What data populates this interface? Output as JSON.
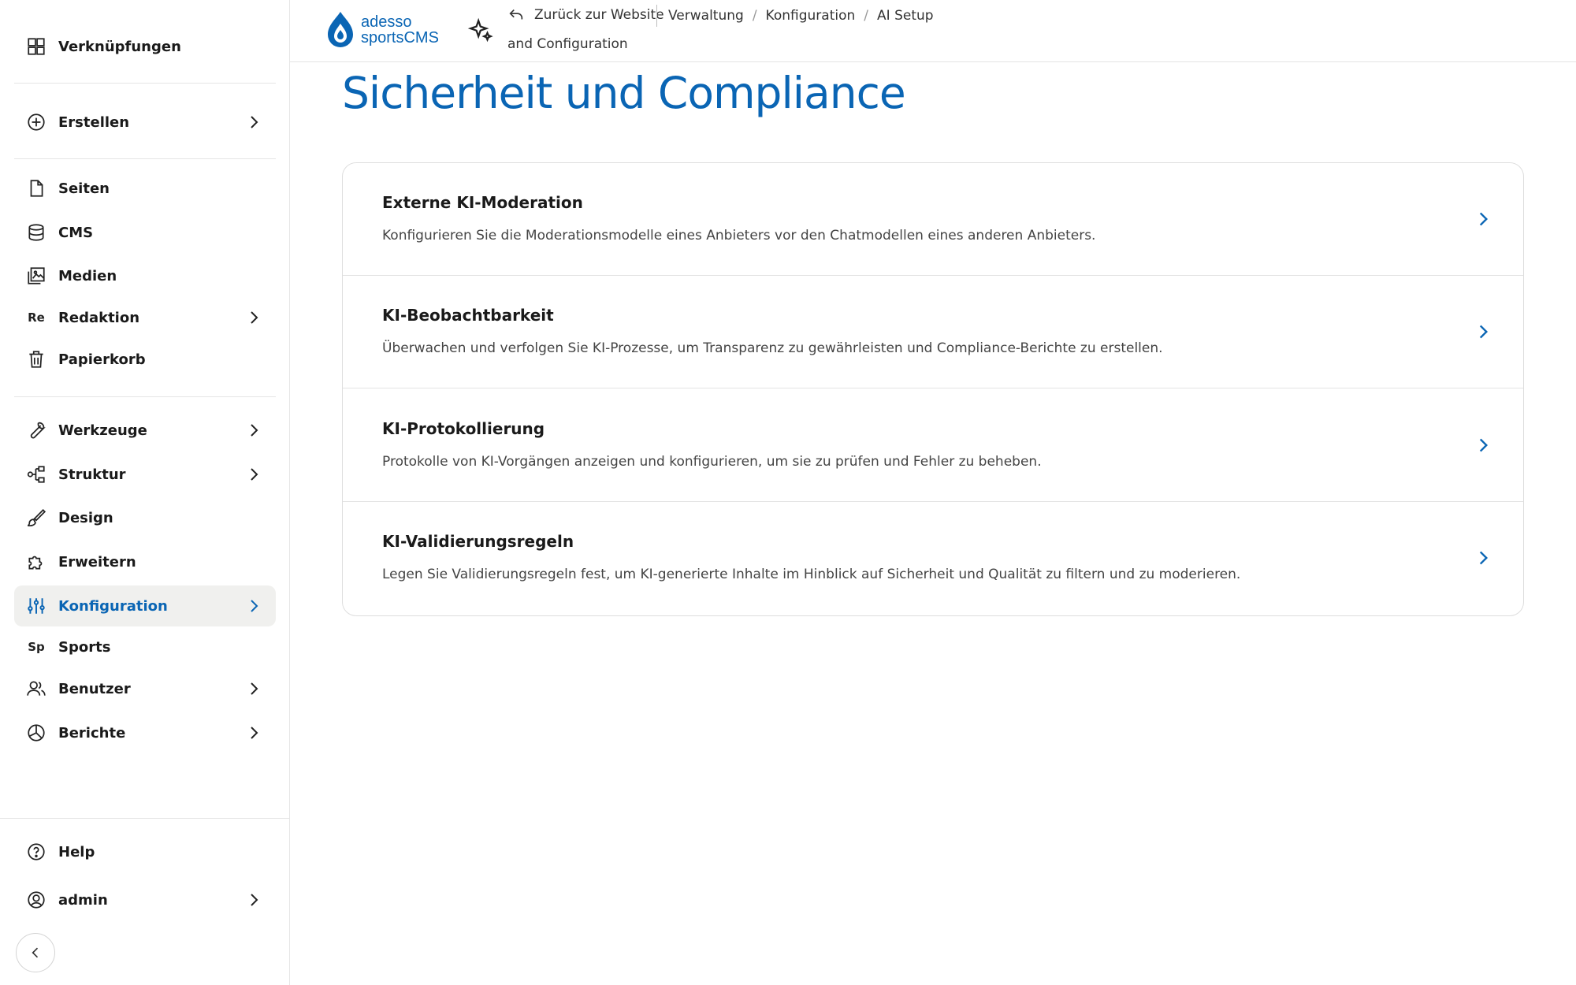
{
  "sidebar": {
    "shortcuts": {
      "label": "Verknüpfungen",
      "icon": "layout-grid-icon"
    },
    "create": {
      "label": "Erstellen",
      "icon": "plus-circle-icon"
    },
    "items": [
      {
        "label": "Seiten",
        "icon": "page-icon"
      },
      {
        "label": "CMS",
        "icon": "database-icon"
      },
      {
        "label": "Medien",
        "icon": "media-icon"
      },
      {
        "label": "Redaktion",
        "icon_text": "Re"
      },
      {
        "label": "Papierkorb",
        "icon": "trash-icon"
      },
      {
        "label": "Werkzeuge",
        "icon": "wrench-icon"
      },
      {
        "label": "Struktur",
        "icon": "structure-icon"
      },
      {
        "label": "Design",
        "icon": "brush-icon"
      },
      {
        "label": "Erweitern",
        "icon": "puzzle-icon"
      },
      {
        "label": "Konfiguration",
        "icon": "sliders-icon"
      },
      {
        "label": "Sports",
        "icon_text": "Sp"
      },
      {
        "label": "Benutzer",
        "icon": "users-icon"
      },
      {
        "label": "Berichte",
        "icon": "pie-chart-icon"
      }
    ],
    "help": {
      "label": "Help",
      "icon": "help-circle-icon"
    },
    "user": {
      "label": "admin",
      "icon": "user-circle-icon"
    }
  },
  "topbar": {
    "logo_line1": "adesso",
    "logo_line2": "sportsCMS",
    "back_label": "Zurück zur Website",
    "breadcrumbs": [
      "Verwaltung",
      "Konfiguration",
      "AI Setup"
    ],
    "breadcrumb_continued": "and Configuration"
  },
  "page": {
    "title": "Sicherheit und Compliance",
    "rows": [
      {
        "title": "Externe KI-Moderation",
        "description": "Konfigurieren Sie die Moderationsmodelle eines Anbieters vor den Chatmodellen eines anderen Anbieters."
      },
      {
        "title": "KI-Beobachtbarkeit",
        "description": "Überwachen und verfolgen Sie KI-Prozesse, um Transparenz zu gewährleisten und Compliance-Berichte zu erstellen."
      },
      {
        "title": "KI-Protokollierung",
        "description": "Protokolle von KI-Vorgängen anzeigen und konfigurieren, um sie zu prüfen und Fehler zu beheben."
      },
      {
        "title": "KI-Validierungsregeln",
        "description": "Legen Sie Validierungsregeln fest, um KI-generierte Inhalte im Hinblick auf Sicherheit und Qualität zu filtern und zu moderieren."
      }
    ]
  },
  "colors": {
    "accent": "#0a65b4",
    "active_bg": "#f0f0ee"
  }
}
